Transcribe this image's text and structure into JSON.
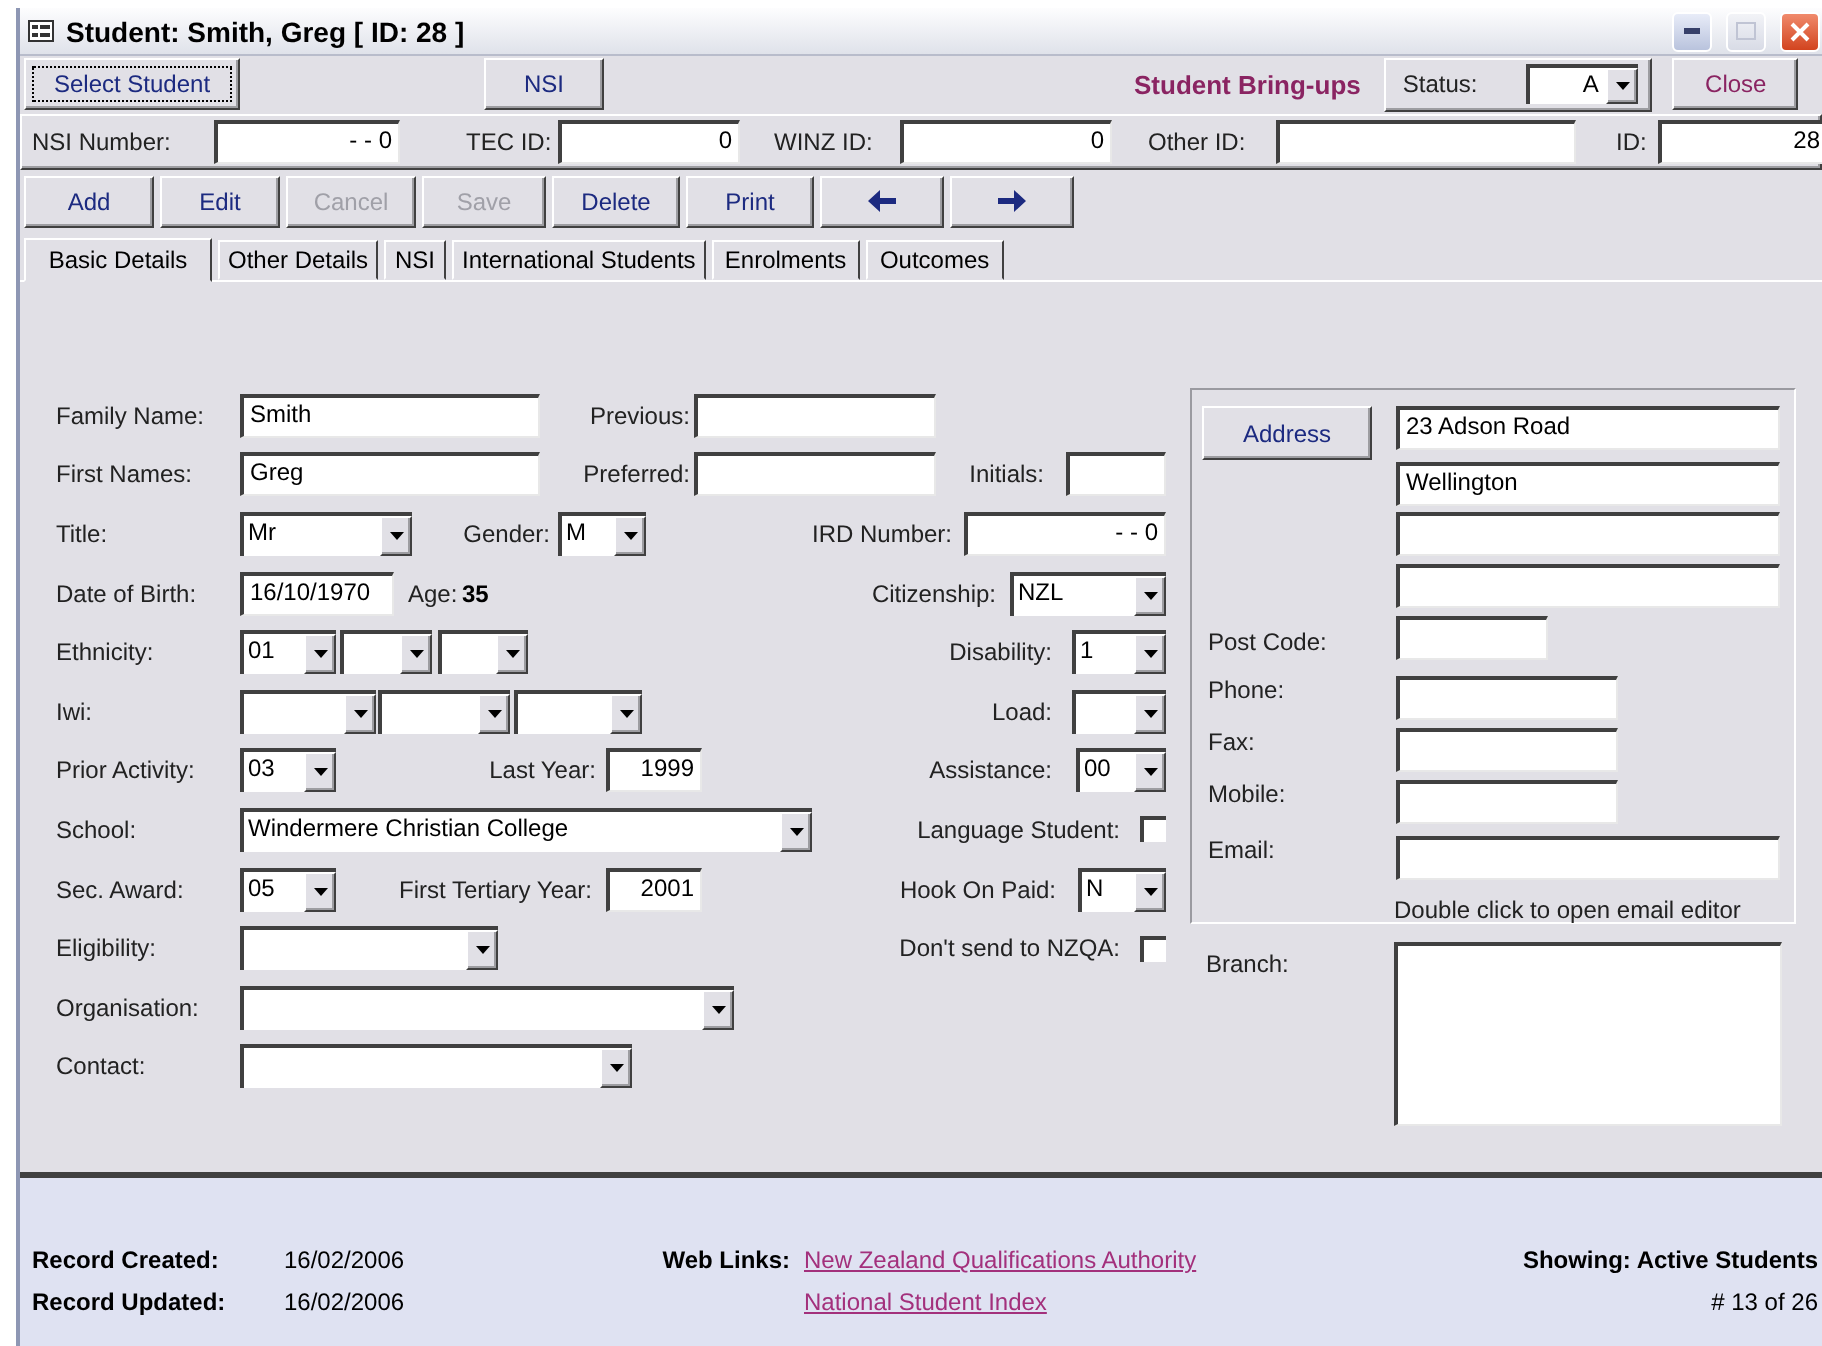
{
  "window": {
    "title": "Student: Smith, Greg [ ID: 28 ]"
  },
  "top_bar": {
    "select_student": "Select Student",
    "nsi": "NSI",
    "bring_ups": "Student Bring-ups",
    "status_label": "Status:",
    "status_value": "A",
    "close": "Close"
  },
  "id_fields": [
    {
      "label": "NSI Number:",
      "value": "- - 0"
    },
    {
      "label": "TEC ID:",
      "value": "0"
    },
    {
      "label": "WINZ ID:",
      "value": "0"
    },
    {
      "label": "Other ID:"
    },
    {
      "label": "ID:",
      "value": "28"
    }
  ],
  "toolbar": [
    {
      "kind": "text",
      "label": "Add",
      "disabled": false
    },
    {
      "kind": "text",
      "label": "Edit",
      "disabled": false
    },
    {
      "kind": "text",
      "label": "Cancel",
      "disabled": true
    },
    {
      "kind": "text",
      "label": "Save",
      "disabled": true
    },
    {
      "kind": "text",
      "label": "Delete",
      "disabled": false
    },
    {
      "kind": "text",
      "label": "Print",
      "disabled": false
    },
    {
      "kind": "arrow-left",
      "disabled": false
    },
    {
      "kind": "arrow-right",
      "disabled": false
    }
  ],
  "tabs": [
    {
      "label": "Basic Details",
      "selected": true
    },
    {
      "label": "Other Details",
      "selected": false
    },
    {
      "label": "NSI",
      "selected": false
    },
    {
      "label": "International Students",
      "selected": false
    },
    {
      "label": "Enrolments",
      "selected": false
    },
    {
      "label": "Outcomes",
      "selected": false
    }
  ],
  "form_rows": [
    [
      {
        "kind": "label",
        "text": "Family Name:"
      },
      {
        "kind": "text",
        "value": "Smith"
      },
      {
        "kind": "label",
        "text": "Previous:"
      },
      {
        "kind": "text"
      }
    ],
    [
      {
        "kind": "label",
        "text": "First Names:"
      },
      {
        "kind": "text",
        "value": "Greg"
      },
      {
        "kind": "label",
        "text": "Preferred:"
      },
      {
        "kind": "text"
      },
      {
        "kind": "label",
        "text": "Initials:"
      },
      {
        "kind": "text"
      }
    ],
    [
      {
        "kind": "label",
        "text": "Title:"
      },
      {
        "kind": "combo",
        "value": "Mr"
      },
      {
        "kind": "label",
        "text": "Gender:"
      },
      {
        "kind": "combo",
        "value": "M"
      },
      {
        "kind": "label",
        "text": "IRD Number:"
      },
      {
        "kind": "text",
        "value": "- - 0"
      }
    ],
    [
      {
        "kind": "label",
        "text": "Date of Birth:"
      },
      {
        "kind": "text",
        "value": "16/10/1970"
      },
      {
        "kind": "label",
        "text": "Age:"
      },
      {
        "kind": "value",
        "text": "35"
      },
      {
        "kind": "label",
        "text": "Citizenship:"
      },
      {
        "kind": "combo",
        "value": "NZL"
      }
    ],
    [
      {
        "kind": "label",
        "text": "Ethnicity:"
      },
      {
        "kind": "combo",
        "value": "01"
      },
      {
        "kind": "combo"
      },
      {
        "kind": "combo"
      },
      {
        "kind": "label",
        "text": "Disability:"
      },
      {
        "kind": "combo",
        "value": "1"
      }
    ],
    [
      {
        "kind": "label",
        "text": "Iwi:"
      },
      {
        "kind": "combo"
      },
      {
        "kind": "combo"
      },
      {
        "kind": "combo"
      },
      {
        "kind": "label",
        "text": "Load:"
      },
      {
        "kind": "combo"
      }
    ],
    [
      {
        "kind": "label",
        "text": "Prior Activity:"
      },
      {
        "kind": "combo",
        "value": "03"
      },
      {
        "kind": "label",
        "text": "Last Year:"
      },
      {
        "kind": "text",
        "value": "1999"
      },
      {
        "kind": "label",
        "text": "Assistance:"
      },
      {
        "kind": "combo",
        "value": "00"
      }
    ],
    [
      {
        "kind": "label",
        "text": "School:"
      },
      {
        "kind": "combo",
        "value": "Windermere Christian College"
      },
      {
        "kind": "label",
        "text": "Language Student:"
      },
      {
        "kind": "checkbox",
        "checked": false
      }
    ],
    [
      {
        "kind": "label",
        "text": "Sec. Award:"
      },
      {
        "kind": "combo",
        "value": "05"
      },
      {
        "kind": "label",
        "text": "First Tertiary Year:"
      },
      {
        "kind": "text",
        "value": "2001"
      },
      {
        "kind": "label",
        "text": "Hook On Paid:"
      },
      {
        "kind": "combo",
        "value": "N"
      }
    ],
    [
      {
        "kind": "label",
        "text": "Eligibility:"
      },
      {
        "kind": "combo"
      },
      {
        "kind": "label",
        "text": "Don't send to NZQA:"
      },
      {
        "kind": "checkbox",
        "checked": false
      }
    ],
    [
      {
        "kind": "label",
        "text": "Organisation:"
      },
      {
        "kind": "combo"
      }
    ],
    [
      {
        "kind": "label",
        "text": "Contact:"
      },
      {
        "kind": "combo"
      }
    ]
  ],
  "address_panel": {
    "button": "Address",
    "lines": [
      {
        "kind": "text",
        "value": "23 Adson Road"
      },
      {
        "kind": "text",
        "value": "Wellington"
      },
      {
        "kind": "text"
      },
      {
        "kind": "text"
      }
    ],
    "contacts": [
      {
        "label": "Post Code:"
      },
      {
        "label": "Phone:"
      },
      {
        "label": "Fax:"
      },
      {
        "label": "Mobile:"
      },
      {
        "label": "Email:"
      }
    ],
    "hint": "Double click to open email editor"
  },
  "branch": {
    "label": "Branch:"
  },
  "footer": {
    "record_created": {
      "label": "Record Created:",
      "value": "16/02/2006"
    },
    "record_updated": {
      "label": "Record Updated:",
      "value": "16/02/2006"
    },
    "web_links_label": "Web Links:",
    "links": [
      "New Zealand Qualifications Authority",
      "National Student Index"
    ],
    "showing": "Showing: Active Students",
    "position": "# 13 of 26"
  }
}
